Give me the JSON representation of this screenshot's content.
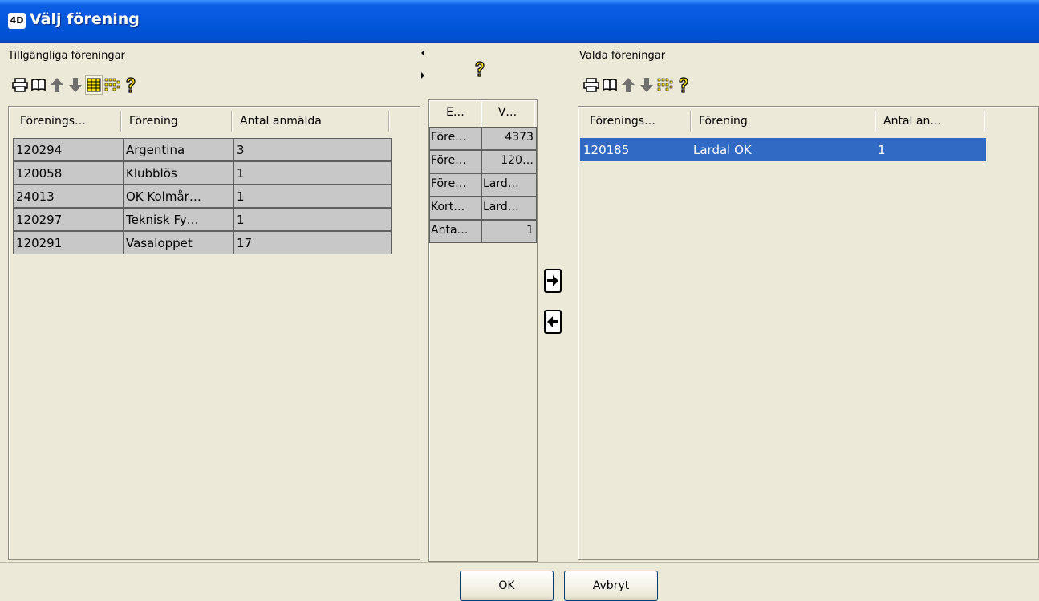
{
  "window": {
    "icon_label": "4D",
    "title": "Välj förening"
  },
  "left": {
    "section_label": "Tillgängliga föreningar",
    "toolbar": [
      "printer-icon",
      "book-icon",
      "arrow-up-icon",
      "arrow-down-icon",
      "grid-icon",
      "sort-icon",
      "help-icon"
    ],
    "columns": [
      "Förenings…",
      "Förening",
      "Antal anmälda"
    ],
    "rows": [
      [
        "120294",
        "Argentina",
        "3"
      ],
      [
        "120058",
        "Klubblös",
        "1"
      ],
      [
        "24013",
        "OK Kolmår…",
        "1"
      ],
      [
        "120297",
        "Teknisk Fy…",
        "1"
      ],
      [
        "120291",
        "Vasaloppet",
        "17"
      ]
    ]
  },
  "middle": {
    "toolbar": [
      "help-icon"
    ],
    "columns": [
      "E…",
      "V…"
    ],
    "rows": [
      [
        "Före…",
        "4373"
      ],
      [
        "Före…",
        "120…"
      ],
      [
        "Före…",
        "Lard…"
      ],
      [
        "Kort…",
        "Lard…"
      ],
      [
        "Anta…",
        "1"
      ]
    ]
  },
  "transfer": {
    "add_icon": "arrow-right-icon",
    "remove_icon": "arrow-left-icon"
  },
  "right": {
    "section_label": "Valda föreningar",
    "toolbar": [
      "printer-icon",
      "book-icon",
      "arrow-up-icon",
      "arrow-down-icon",
      "sort-icon",
      "help-icon"
    ],
    "columns": [
      "Förenings…",
      "Förening",
      "Antal an…"
    ],
    "rows": [
      [
        "120185",
        "Lardal OK",
        "1"
      ]
    ]
  },
  "buttons": {
    "ok": "OK",
    "cancel": "Avbryt"
  },
  "colors": {
    "titlebar": "#0458dc",
    "selection": "#316ac5",
    "row_bg": "#c8c8c8",
    "window_bg": "#ece9d8",
    "icon_yellow": "#ffe600"
  }
}
